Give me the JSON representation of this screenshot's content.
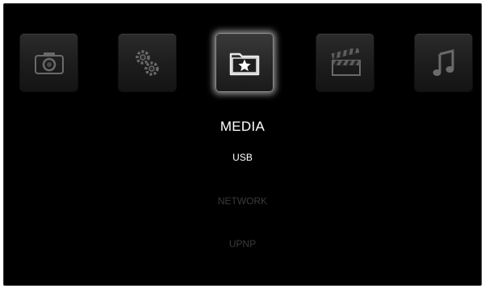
{
  "categories": [
    {
      "id": "photo",
      "icon": "camera-icon",
      "selected": false
    },
    {
      "id": "settings",
      "icon": "gears-icon",
      "selected": false
    },
    {
      "id": "media",
      "icon": "star-folder-icon",
      "selected": true
    },
    {
      "id": "movies",
      "icon": "clapperboard-icon",
      "selected": false
    },
    {
      "id": "music",
      "icon": "music-note-icon",
      "selected": false
    }
  ],
  "section_title": "MEDIA",
  "menu": {
    "items": [
      {
        "label": "USB",
        "state": "active"
      },
      {
        "label": "NETWORK",
        "state": "inactive"
      },
      {
        "label": "UPNP",
        "state": "inactive"
      }
    ]
  },
  "colors": {
    "background": "#000000",
    "active_text": "#ffffff",
    "inactive_text": "#3a3a3a"
  }
}
